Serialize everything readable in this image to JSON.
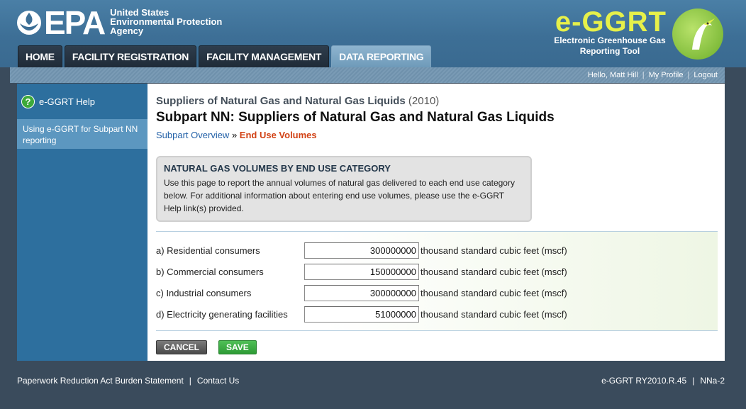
{
  "header": {
    "agency_line1": "United States",
    "agency_line2": "Environmental Protection",
    "agency_line3": "Agency",
    "logo_text": "EPA",
    "app_title": "e-GGRT",
    "app_subtitle_line1": "Electronic Greenhouse Gas",
    "app_subtitle_line2": "Reporting Tool"
  },
  "tabs": [
    {
      "label": "HOME"
    },
    {
      "label": "FACILITY REGISTRATION"
    },
    {
      "label": "FACILITY MANAGEMENT"
    },
    {
      "label": "DATA REPORTING"
    }
  ],
  "userbar": {
    "greeting": "Hello, Matt Hill",
    "profile": "My Profile",
    "logout": "Logout"
  },
  "sidebar": {
    "help_label": "e-GGRT Help",
    "link_label": "Using e-GGRT for Subpart NN reporting"
  },
  "main": {
    "supertitle": "Suppliers of Natural Gas and Natural Gas Liquids",
    "year": "(2010)",
    "title": "Subpart NN: Suppliers of Natural Gas and Natural Gas Liquids",
    "crumb_link": "Subpart Overview",
    "crumb_sep": " » ",
    "crumb_current": "End Use Volumes",
    "info_title": "NATURAL GAS VOLUMES BY END USE CATEGORY",
    "info_text": "Use this page to report the annual volumes of natural gas delivered to each end use category below. For additional information about entering end use volumes, please use the e-GGRT Help link(s) provided."
  },
  "rows": [
    {
      "label": "a) Residential consumers",
      "value": "300000000",
      "unit": "thousand standard cubic feet (mscf)"
    },
    {
      "label": "b) Commercial consumers",
      "value": "150000000",
      "unit": "thousand standard cubic feet (mscf)"
    },
    {
      "label": "c) Industrial consumers",
      "value": "300000000",
      "unit": "thousand standard cubic feet (mscf)"
    },
    {
      "label": "d) Electricity generating facilities",
      "value": "51000000",
      "unit": "thousand standard cubic feet (mscf)"
    }
  ],
  "buttons": {
    "cancel": "CANCEL",
    "save": "SAVE"
  },
  "footer": {
    "paperwork": "Paperwork Reduction Act Burden Statement",
    "contact": "Contact Us",
    "version": "e-GGRT RY2010.R.45",
    "page_code": "NNa-2"
  }
}
